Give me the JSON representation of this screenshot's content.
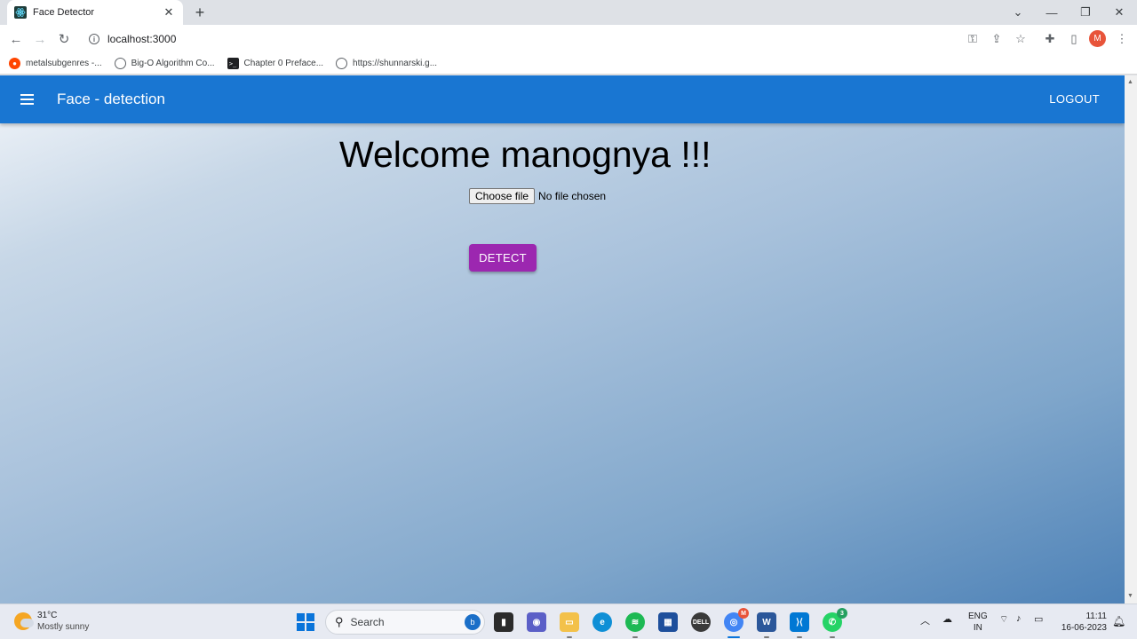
{
  "browser": {
    "tab_title": "Face Detector",
    "url": "localhost:3000",
    "profile_initial": "M",
    "bookmarks": [
      {
        "label": "metalsubgenres -...",
        "icon": "reddit-icon"
      },
      {
        "label": "Big-O Algorithm Co...",
        "icon": "globe-icon"
      },
      {
        "label": "Chapter 0 Preface...",
        "icon": "terminal-icon"
      },
      {
        "label": "https://shunnarski.g...",
        "icon": "globe-icon"
      }
    ]
  },
  "app": {
    "title": "Face - detection",
    "logout_label": "LOGOUT",
    "welcome_text": "Welcome manognya !!!",
    "choose_file_label": "Choose file",
    "file_status": "No file chosen",
    "detect_label": "DETECT",
    "colors": {
      "appbar": "#1976d2",
      "detect": "#9c27b0"
    }
  },
  "taskbar": {
    "temperature": "31°C",
    "condition": "Mostly sunny",
    "search_label": "Search",
    "lang_top": "ENG",
    "lang_bottom": "IN",
    "time": "11:11",
    "date": "16-06-2023",
    "chrome_badge": "M",
    "whatsapp_badge": "3"
  }
}
